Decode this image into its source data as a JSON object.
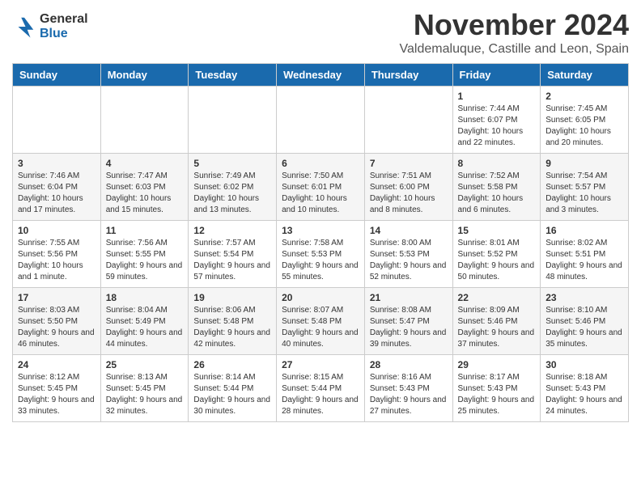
{
  "logo": {
    "general": "General",
    "blue": "Blue"
  },
  "title": {
    "month": "November 2024",
    "location": "Valdemaluque, Castille and Leon, Spain"
  },
  "headers": [
    "Sunday",
    "Monday",
    "Tuesday",
    "Wednesday",
    "Thursday",
    "Friday",
    "Saturday"
  ],
  "weeks": [
    [
      {
        "day": "",
        "info": ""
      },
      {
        "day": "",
        "info": ""
      },
      {
        "day": "",
        "info": ""
      },
      {
        "day": "",
        "info": ""
      },
      {
        "day": "",
        "info": ""
      },
      {
        "day": "1",
        "info": "Sunrise: 7:44 AM\nSunset: 6:07 PM\nDaylight: 10 hours and 22 minutes."
      },
      {
        "day": "2",
        "info": "Sunrise: 7:45 AM\nSunset: 6:05 PM\nDaylight: 10 hours and 20 minutes."
      }
    ],
    [
      {
        "day": "3",
        "info": "Sunrise: 7:46 AM\nSunset: 6:04 PM\nDaylight: 10 hours and 17 minutes."
      },
      {
        "day": "4",
        "info": "Sunrise: 7:47 AM\nSunset: 6:03 PM\nDaylight: 10 hours and 15 minutes."
      },
      {
        "day": "5",
        "info": "Sunrise: 7:49 AM\nSunset: 6:02 PM\nDaylight: 10 hours and 13 minutes."
      },
      {
        "day": "6",
        "info": "Sunrise: 7:50 AM\nSunset: 6:01 PM\nDaylight: 10 hours and 10 minutes."
      },
      {
        "day": "7",
        "info": "Sunrise: 7:51 AM\nSunset: 6:00 PM\nDaylight: 10 hours and 8 minutes."
      },
      {
        "day": "8",
        "info": "Sunrise: 7:52 AM\nSunset: 5:58 PM\nDaylight: 10 hours and 6 minutes."
      },
      {
        "day": "9",
        "info": "Sunrise: 7:54 AM\nSunset: 5:57 PM\nDaylight: 10 hours and 3 minutes."
      }
    ],
    [
      {
        "day": "10",
        "info": "Sunrise: 7:55 AM\nSunset: 5:56 PM\nDaylight: 10 hours and 1 minute."
      },
      {
        "day": "11",
        "info": "Sunrise: 7:56 AM\nSunset: 5:55 PM\nDaylight: 9 hours and 59 minutes."
      },
      {
        "day": "12",
        "info": "Sunrise: 7:57 AM\nSunset: 5:54 PM\nDaylight: 9 hours and 57 minutes."
      },
      {
        "day": "13",
        "info": "Sunrise: 7:58 AM\nSunset: 5:53 PM\nDaylight: 9 hours and 55 minutes."
      },
      {
        "day": "14",
        "info": "Sunrise: 8:00 AM\nSunset: 5:53 PM\nDaylight: 9 hours and 52 minutes."
      },
      {
        "day": "15",
        "info": "Sunrise: 8:01 AM\nSunset: 5:52 PM\nDaylight: 9 hours and 50 minutes."
      },
      {
        "day": "16",
        "info": "Sunrise: 8:02 AM\nSunset: 5:51 PM\nDaylight: 9 hours and 48 minutes."
      }
    ],
    [
      {
        "day": "17",
        "info": "Sunrise: 8:03 AM\nSunset: 5:50 PM\nDaylight: 9 hours and 46 minutes."
      },
      {
        "day": "18",
        "info": "Sunrise: 8:04 AM\nSunset: 5:49 PM\nDaylight: 9 hours and 44 minutes."
      },
      {
        "day": "19",
        "info": "Sunrise: 8:06 AM\nSunset: 5:48 PM\nDaylight: 9 hours and 42 minutes."
      },
      {
        "day": "20",
        "info": "Sunrise: 8:07 AM\nSunset: 5:48 PM\nDaylight: 9 hours and 40 minutes."
      },
      {
        "day": "21",
        "info": "Sunrise: 8:08 AM\nSunset: 5:47 PM\nDaylight: 9 hours and 39 minutes."
      },
      {
        "day": "22",
        "info": "Sunrise: 8:09 AM\nSunset: 5:46 PM\nDaylight: 9 hours and 37 minutes."
      },
      {
        "day": "23",
        "info": "Sunrise: 8:10 AM\nSunset: 5:46 PM\nDaylight: 9 hours and 35 minutes."
      }
    ],
    [
      {
        "day": "24",
        "info": "Sunrise: 8:12 AM\nSunset: 5:45 PM\nDaylight: 9 hours and 33 minutes."
      },
      {
        "day": "25",
        "info": "Sunrise: 8:13 AM\nSunset: 5:45 PM\nDaylight: 9 hours and 32 minutes."
      },
      {
        "day": "26",
        "info": "Sunrise: 8:14 AM\nSunset: 5:44 PM\nDaylight: 9 hours and 30 minutes."
      },
      {
        "day": "27",
        "info": "Sunrise: 8:15 AM\nSunset: 5:44 PM\nDaylight: 9 hours and 28 minutes."
      },
      {
        "day": "28",
        "info": "Sunrise: 8:16 AM\nSunset: 5:43 PM\nDaylight: 9 hours and 27 minutes."
      },
      {
        "day": "29",
        "info": "Sunrise: 8:17 AM\nSunset: 5:43 PM\nDaylight: 9 hours and 25 minutes."
      },
      {
        "day": "30",
        "info": "Sunrise: 8:18 AM\nSunset: 5:43 PM\nDaylight: 9 hours and 24 minutes."
      }
    ]
  ]
}
